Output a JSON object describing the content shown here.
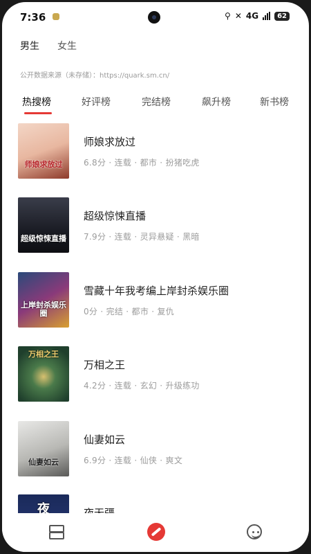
{
  "status_bar": {
    "time": "7:36",
    "network": "4G",
    "battery": "62"
  },
  "gender_tabs": [
    {
      "label": "男生"
    },
    {
      "label": "女生"
    }
  ],
  "source_note": "公开数据来源（未存储）：https://quark.sm.cn/",
  "rank_tabs": [
    {
      "label": "热搜榜",
      "active": true
    },
    {
      "label": "好评榜"
    },
    {
      "label": "完结榜"
    },
    {
      "label": "飙升榜"
    },
    {
      "label": "新书榜"
    }
  ],
  "books": [
    {
      "title": "师娘求放过",
      "meta": "6.8分 · 连载 · 都市 · 扮猪吃虎",
      "cover_text": "师娘求放过"
    },
    {
      "title": "超级惊悚直播",
      "meta": "7.9分 · 连载 · 灵异悬疑 · 黑暗",
      "cover_text": "超级惊悚直播"
    },
    {
      "title": "雪藏十年我考编上岸封杀娱乐圈",
      "meta": "0分 · 完结 · 都市 · 复仇",
      "cover_text": "上岸封杀娱乐圈"
    },
    {
      "title": "万相之王",
      "meta": "4.2分 · 连载 · 玄幻 · 升级练功",
      "cover_text": "万相之王"
    },
    {
      "title": "仙妻如云",
      "meta": "6.9分 · 连载 · 仙侠 · 爽文",
      "cover_text": "仙妻如云"
    },
    {
      "title": "夜无疆",
      "meta": "",
      "cover_text": "夜"
    }
  ],
  "colors": {
    "accent": "#e53935"
  },
  "bottom_nav": [
    {
      "icon": "bookshelf-icon"
    },
    {
      "icon": "compass-icon"
    },
    {
      "icon": "smile-icon"
    }
  ]
}
